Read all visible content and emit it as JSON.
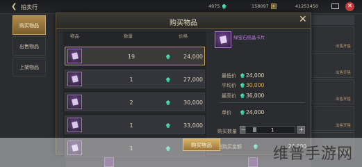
{
  "topbar": {
    "back_icon": "chevron-left-icon",
    "title": "拍卖行",
    "resources": [
      "4975",
      "158097",
      "41253450"
    ]
  },
  "sidebar": {
    "items": [
      {
        "label": "购买物品",
        "active": true
      },
      {
        "label": "出售物品",
        "active": false
      },
      {
        "label": "上架物品",
        "active": false
      }
    ]
  },
  "right_panel": {
    "rows": [
      "出售开售",
      "出售开售",
      "出售开售",
      "出售开售",
      "出售开售"
    ]
  },
  "modal": {
    "title": "购买物品",
    "close_icon": "close-icon",
    "columns": {
      "item": "物品",
      "qty": "数量",
      "price": "价格"
    },
    "rows": [
      {
        "qty": "19",
        "price": "24,000",
        "selected": true
      },
      {
        "qty": "1",
        "price": "27,000",
        "selected": false
      },
      {
        "qty": "2",
        "price": "30,000",
        "selected": false
      },
      {
        "qty": "1",
        "price": "33,000",
        "selected": false
      },
      {
        "qty": "1",
        "price": "36,000",
        "selected": false
      }
    ],
    "detail": {
      "item_name": "绿宝石结晶卡片",
      "min_label": "最低价",
      "min_value": "24,000",
      "avg_label": "平均价",
      "avg_value": "30,000",
      "max_label": "最高价",
      "max_value": "36,000",
      "unit_label": "单价",
      "unit_value": "24,000",
      "qty_label": "购买数量",
      "qty_value": "1",
      "minus_label": "−",
      "plus_label": "+",
      "total_label": "总购买金额",
      "total_value": "24,000",
      "buy_label": "购买物品"
    }
  },
  "watermark": "维普手游网",
  "colors": {
    "gold": "#c7a35a",
    "gem": "#2fd6a0",
    "rare_purple": "#c17ae8",
    "avg_price": "#e0b040"
  }
}
